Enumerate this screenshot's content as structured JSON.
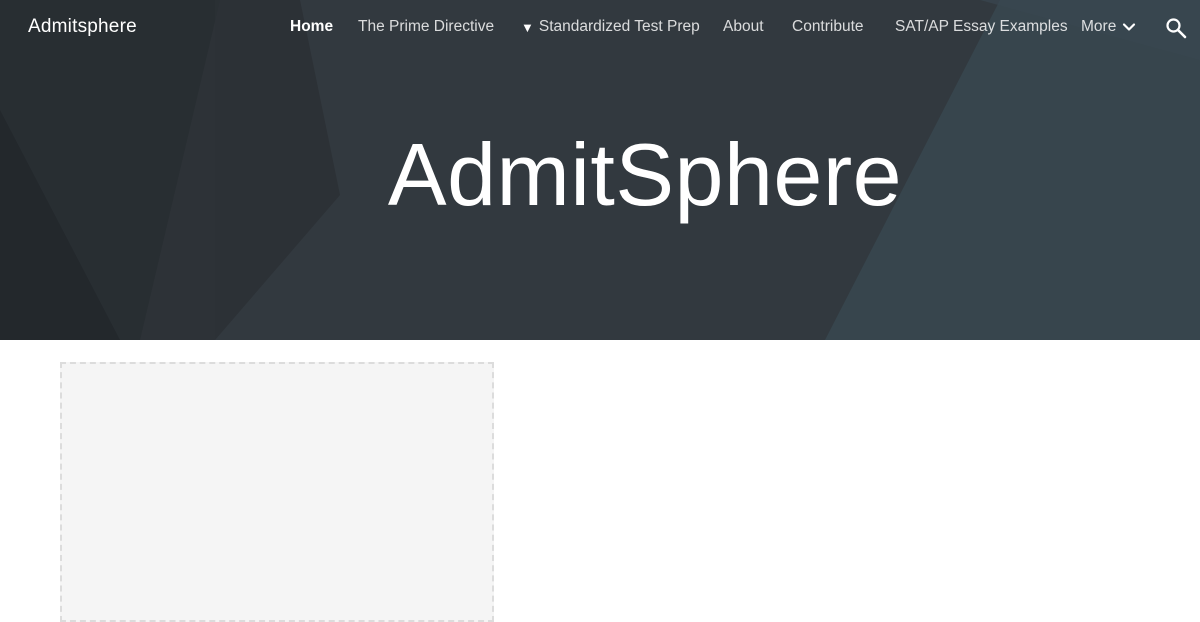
{
  "site": {
    "name": "Admitsphere"
  },
  "nav": {
    "items": [
      {
        "label": "Home",
        "active": true
      },
      {
        "label": "The Prime Directive"
      },
      {
        "label": "Standardized Test Prep",
        "icon": "triangle-down-icon"
      },
      {
        "label": "About"
      },
      {
        "label": "Contribute"
      },
      {
        "label": "SAT/AP Essay Examples"
      },
      {
        "label": "More",
        "icon": "chevron-down-icon"
      }
    ],
    "search_icon": "search-icon",
    "arrow_glyph": "▼"
  },
  "hero": {
    "title": "AdmitSphere",
    "background_color": "#33393f"
  },
  "content": {
    "placeholder_background": "#f5f5f5"
  }
}
